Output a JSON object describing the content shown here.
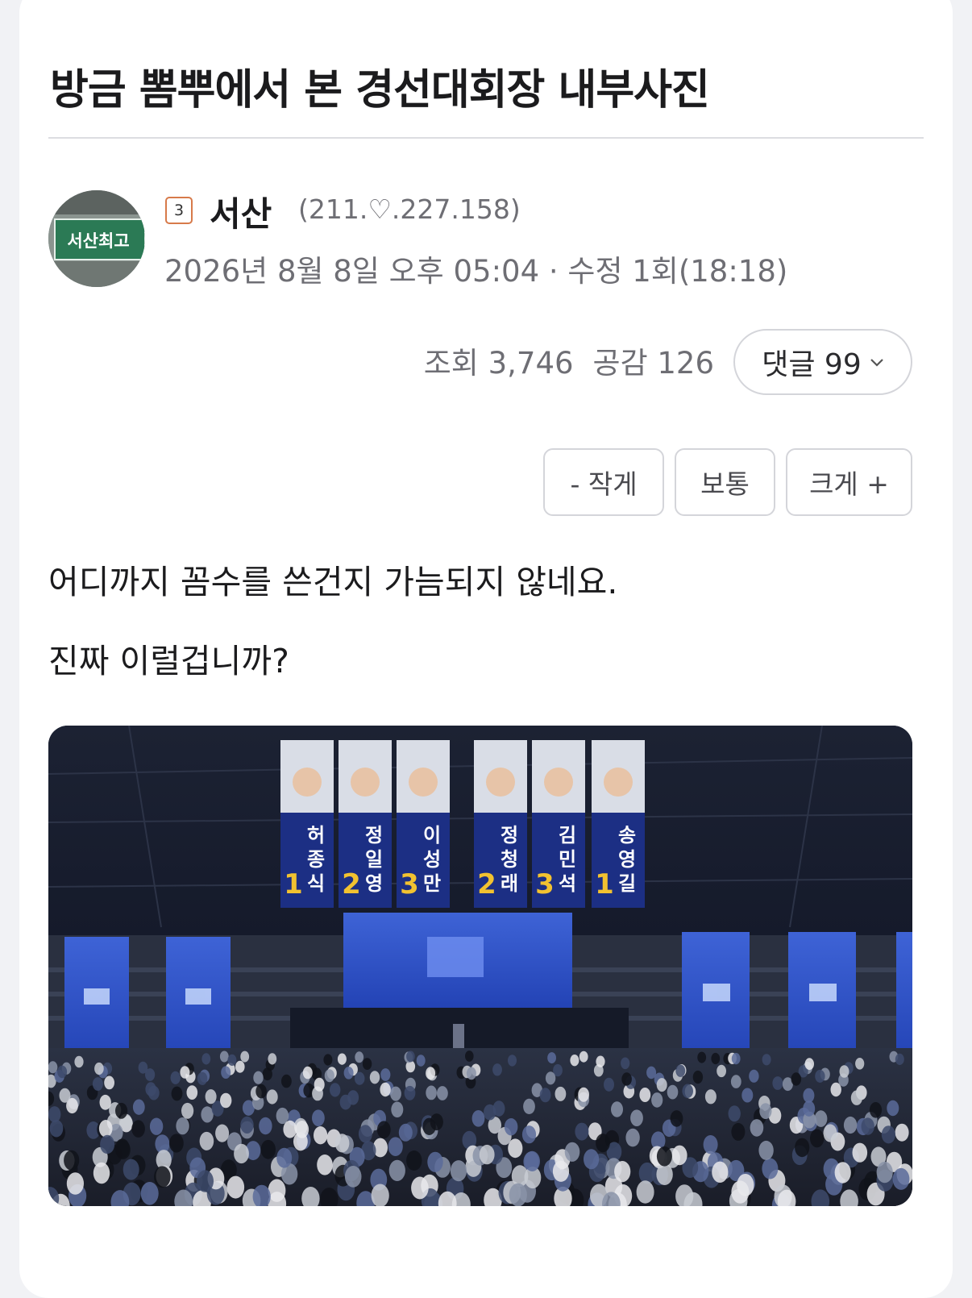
{
  "post": {
    "title": "방금 뽐뿌에서 본 경선대회장 내부사진",
    "author": {
      "grade": "3",
      "name": "서산",
      "ip": "(211.♡.227.158)",
      "avatar_text": "서산최고"
    },
    "datetime": "2026년 8월 8일 오후 05:04 · 수정 1회(18:18)",
    "stats": {
      "views": "조회 3,746",
      "likes": "공감 126",
      "comments": "댓글 99"
    },
    "font_size_buttons": [
      "- 작게",
      "보통",
      "크게 +"
    ],
    "body": [
      "어디까지 꼼수를 쓴건지 가늠되지 않네요.",
      "진짜 이럴겁니까?"
    ]
  },
  "photo": {
    "description_icon": "photo-image",
    "banners": [
      {
        "number": "1",
        "name": "허종식"
      },
      {
        "number": "2",
        "name": "정일영"
      },
      {
        "number": "3",
        "name": "이성만"
      },
      {
        "number": "2",
        "name": "정청래"
      },
      {
        "number": "3",
        "name": "김민석"
      },
      {
        "number": "1",
        "name": "송영길"
      }
    ]
  }
}
